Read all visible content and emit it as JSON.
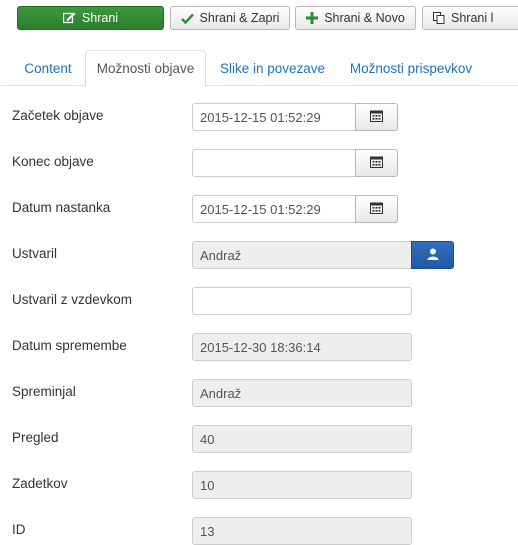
{
  "toolbar": {
    "save_label": "Shrani",
    "save_close_label": "Shrani & Zapri",
    "save_new_label": "Shrani & Novo",
    "save_copy_label": "Shrani l",
    "colors": {
      "save": "#2f8c33",
      "primary": "#1f5aa3"
    }
  },
  "tabs": [
    {
      "label": "Content",
      "active": false
    },
    {
      "label": "Možnosti objave",
      "active": true
    },
    {
      "label": "Slike in povezave",
      "active": false
    },
    {
      "label": "Možnosti prispevkov",
      "active": false
    }
  ],
  "form": {
    "publish_up": {
      "label": "Začetek objave",
      "value": "2015-12-15 01:52:29",
      "icon": "calendar-icon"
    },
    "publish_down": {
      "label": "Konec objave",
      "value": "",
      "icon": "calendar-icon"
    },
    "created": {
      "label": "Datum nastanka",
      "value": "2015-12-15 01:52:29",
      "icon": "calendar-icon"
    },
    "created_by": {
      "label": "Ustvaril",
      "value": "Andraž",
      "icon": "user-icon"
    },
    "created_by_alias": {
      "label": "Ustvaril z vzdevkom",
      "value": ""
    },
    "modified": {
      "label": "Datum spremembe",
      "value": "2015-12-30 18:36:14"
    },
    "modified_by": {
      "label": "Spreminjal",
      "value": "Andraž"
    },
    "hits": {
      "label": "Pregled",
      "value": "40"
    },
    "votes": {
      "label": "Zadetkov",
      "value": "10"
    },
    "id": {
      "label": "ID",
      "value": "13"
    }
  }
}
